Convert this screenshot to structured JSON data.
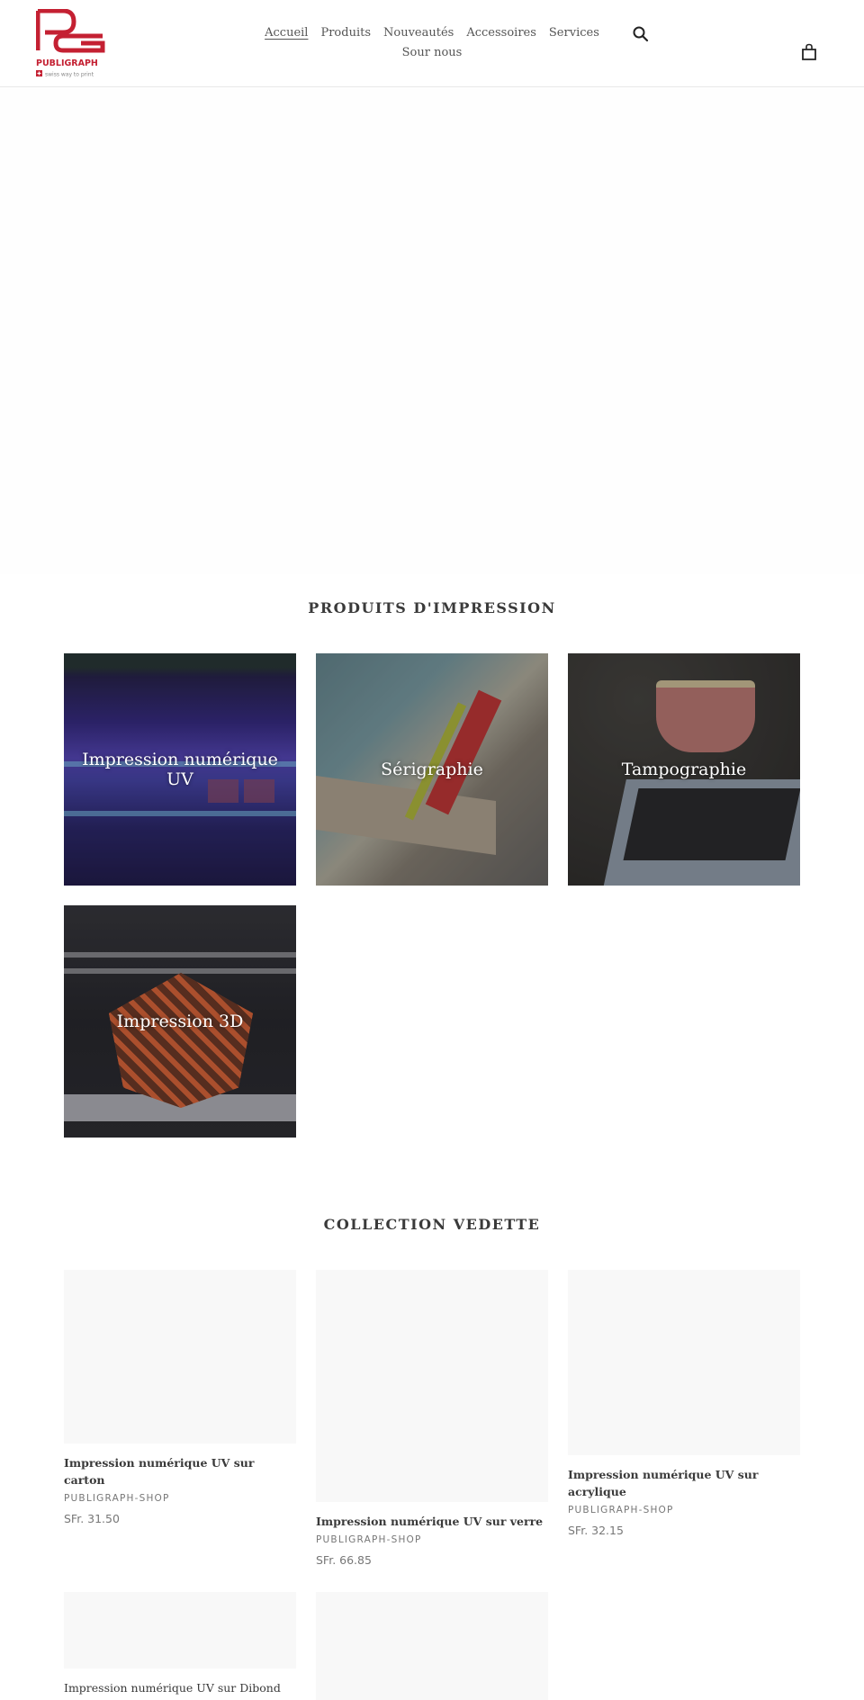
{
  "header": {
    "logo": {
      "brand": "PUBLIGRAPH",
      "tagline": "swiss way to print",
      "brand_color": "#c42032"
    },
    "nav": [
      {
        "label": "Accueil",
        "active": true
      },
      {
        "label": "Produits",
        "active": false
      },
      {
        "label": "Nouveautés",
        "active": false
      },
      {
        "label": "Accessoires",
        "active": false
      },
      {
        "label": "Services",
        "active": false
      },
      {
        "label": "Sour nous",
        "active": false
      }
    ],
    "icons": {
      "search": "search-icon",
      "cart": "cart-icon"
    }
  },
  "collections_section": {
    "title": "PRODUITS D'IMPRESSION",
    "items": [
      {
        "label": "Impression numérique UV"
      },
      {
        "label": "Sérigraphie"
      },
      {
        "label": "Tampographie"
      },
      {
        "label": "Impression 3D"
      }
    ]
  },
  "featured_section": {
    "title": "COLLECTION VEDETTE",
    "products": [
      {
        "title": "Impression numérique UV sur carton",
        "vendor": "PUBLIGRAPH-SHOP",
        "price": "SFr. 31.50"
      },
      {
        "title": "Impression numérique UV sur verre",
        "vendor": "PUBLIGRAPH-SHOP",
        "price": "SFr. 66.85"
      },
      {
        "title": "Impression numérique UV sur acrylique",
        "vendor": "PUBLIGRAPH-SHOP",
        "price": "SFr. 32.15"
      },
      {
        "title": "Impression numérique UV sur Dibond",
        "vendor": "",
        "price": ""
      },
      {
        "title": "",
        "vendor": "",
        "price": ""
      }
    ]
  }
}
